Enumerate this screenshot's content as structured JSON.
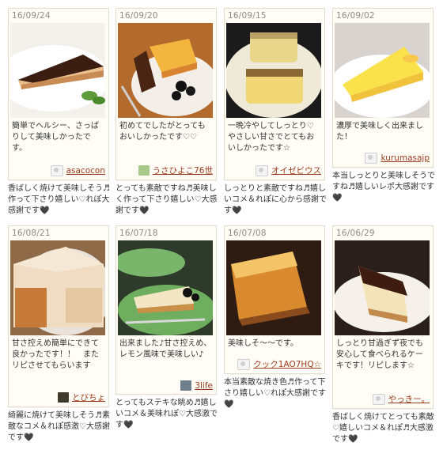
{
  "reports": [
    {
      "date": "16/09/24",
      "text": "簡単でヘルシー、さっぱりして美味しかったです。",
      "user": "asacocon",
      "user_icon": "default-avatar-icon",
      "comment": "香ばしく焼けて美味しそう♬作って下さり嬉しい♡れぽ大感謝です🖤"
    },
    {
      "date": "16/09/20",
      "text": "初めてでしたがとってもおいしかったです♡♡",
      "user": "うさひよこ76世",
      "user_icon": "photo-avatar",
      "comment": "とっても素敵ですね♬美味しく作って下さり嬉しい♡大感謝です🖤"
    },
    {
      "date": "16/09/15",
      "text": "一晩冷やしてしっとり♡やさしい甘さでとてもおいしかったです☆",
      "user": "オイゼビウス",
      "user_icon": "default-avatar-icon",
      "comment": "しっとりと素敵ですね♬嬉しいコメ＆れぽに心から感謝です🖤"
    },
    {
      "date": "16/09/02",
      "text": "濃厚で美味しく出来ました！",
      "user": "kurumasajp",
      "user_icon": "default-avatar-icon",
      "comment": "本当しっとりと美味しそうですね♬嬉しいレポ大感謝です🖤"
    },
    {
      "date": "16/08/21",
      "text": "甘さ控えめ簡単にできて良かったです！！　またリピさせてもらいます",
      "user": "とびちょ",
      "user_icon": "photo-avatar",
      "comment": "綺麗に焼けて美味しそう♬素敵なコメ＆れぽ感激♡大感謝です🖤"
    },
    {
      "date": "16/07/18",
      "text": "出来ました♪甘さ控えめ、レモン風味で美味しい♪",
      "user": "3life",
      "user_icon": "photo-avatar",
      "comment": "とってもステキな眺め♬嬉しいコメ＆美味れぽ♡大感激です🖤"
    },
    {
      "date": "16/07/08",
      "text": "美味しそ〜〜です。",
      "user": "クック1AO7HQ☆",
      "user_icon": "default-avatar-icon",
      "comment": "本当素敵な焼き色♬作って下さり嬉しい♡れぽ大感謝です🖤"
    },
    {
      "date": "16/06/29",
      "text": "しっとり甘過ぎず夜でも安心して食べられるケーキです！リピします☆",
      "user": "やっきー。",
      "user_icon": "default-avatar-icon",
      "comment": "香ばしく焼けてとっても素敵♡嬉しいコメ＆れぽ♬大感激です🖤"
    }
  ],
  "colors": {
    "card_bg": "#fffdf6",
    "card_border": "#e3dccb",
    "username": "#9c3b1c",
    "date": "#8a8a8a"
  }
}
